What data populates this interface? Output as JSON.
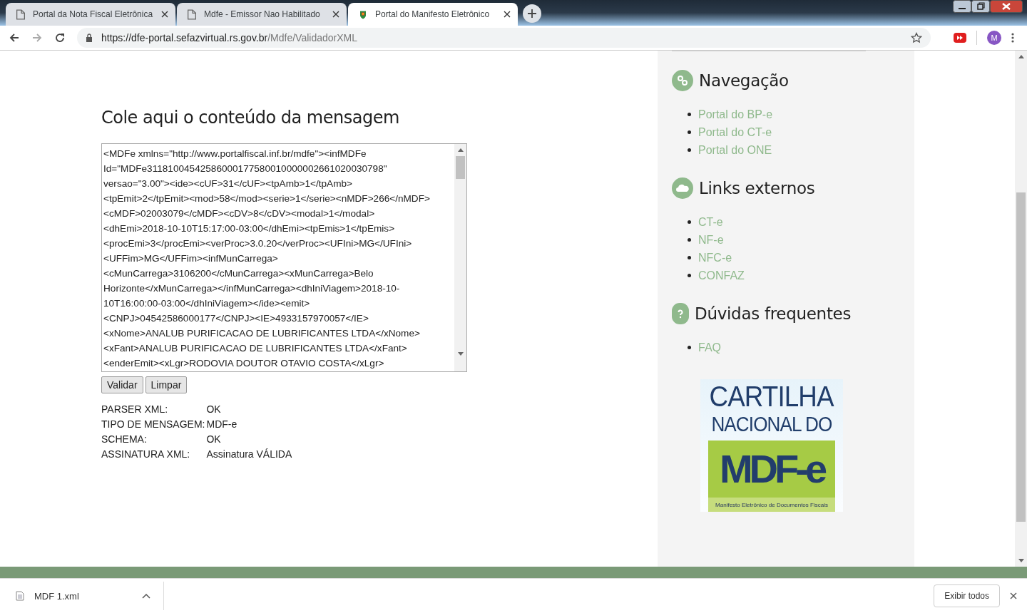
{
  "browser": {
    "tabs": [
      {
        "title": "Portal da Nota Fiscal Eletrônica",
        "selected": false,
        "kind": "doc"
      },
      {
        "title": "Mdfe - Emissor Nao Habilitado",
        "selected": false,
        "kind": "doc"
      },
      {
        "title": "Portal do Manifesto Eletrônico",
        "selected": true,
        "kind": "crest"
      }
    ],
    "url_host": "https://dfe-portal.sefazvirtual.rs.gov.br",
    "url_path": "/Mdfe/ValidadorXML",
    "profile_initial": "M"
  },
  "main": {
    "heading": "Cole aqui o conteúdo da mensagem",
    "xml_lines": [
      "<MDFe xmlns=\"http://www.portalfiscal.inf.br/mdfe\"><infMDFe",
      "Id=\"MDFe31181004542586000177580010000002661020030798\"",
      "versao=\"3.00\"><ide><cUF>31</cUF><tpAmb>1</tpAmb>",
      "<tpEmit>2</tpEmit><mod>58</mod><serie>1</serie><nMDF>266</nMDF>",
      "<cMDF>02003079</cMDF><cDV>8</cDV><modal>1</modal>",
      "<dhEmi>2018-10-10T15:17:00-03:00</dhEmi><tpEmis>1</tpEmis>",
      "<procEmi>3</procEmi><verProc>3.0.20</verProc><UFIni>MG</UFIni>",
      "<UFFim>MG</UFFim><infMunCarrega>",
      "<cMunCarrega>3106200</cMunCarrega><xMunCarrega>Belo",
      "Horizonte</xMunCarrega></infMunCarrega><dhIniViagem>2018-10-",
      "10T16:00:00-03:00</dhIniViagem></ide><emit>",
      "<CNPJ>04542586000177</CNPJ><IE>4933157970057</IE>",
      "<xNome>ANALUB PURIFICACAO DE LUBRIFICANTES LTDA</xNome>",
      "<xFant>ANALUB PURIFICACAO DE LUBRIFICANTES LTDA</xFant>",
      "<enderEmit><xLgr>RODOVIA DOUTOR OTAVIO COSTA</xLgr>"
    ],
    "buttons": [
      "Validar",
      "Limpar"
    ],
    "results": [
      {
        "label": "PARSER XML:",
        "value": "OK"
      },
      {
        "label": "TIPO DE MENSAGEM:",
        "value": "MDF-e"
      },
      {
        "label": "SCHEMA:",
        "value": "OK"
      },
      {
        "label": "ASSINATURA XML:",
        "value": "Assinatura VÁLIDA"
      }
    ]
  },
  "sidebar": {
    "sections": [
      {
        "title": "Navegação",
        "kind": "link",
        "links": [
          "Portal do BP-e",
          "Portal do CT-e",
          "Portal do ONE"
        ]
      },
      {
        "title": "Links externos",
        "kind": "cloud",
        "links": [
          "CT-e",
          "NF-e",
          "NFC-e",
          "CONFAZ"
        ]
      },
      {
        "title": "Dúvidas frequentes",
        "kind": "question",
        "links": [
          "FAQ"
        ]
      }
    ],
    "banner": {
      "line_1": "CARTILHA",
      "line_2": "NACIONAL DO",
      "brand": "MDF-e",
      "caption": "Manifesto Eletrônico de Documentos Fiscais"
    }
  },
  "downloads": {
    "file": "MDF 1.xml",
    "show_all": "Exibir todos"
  }
}
